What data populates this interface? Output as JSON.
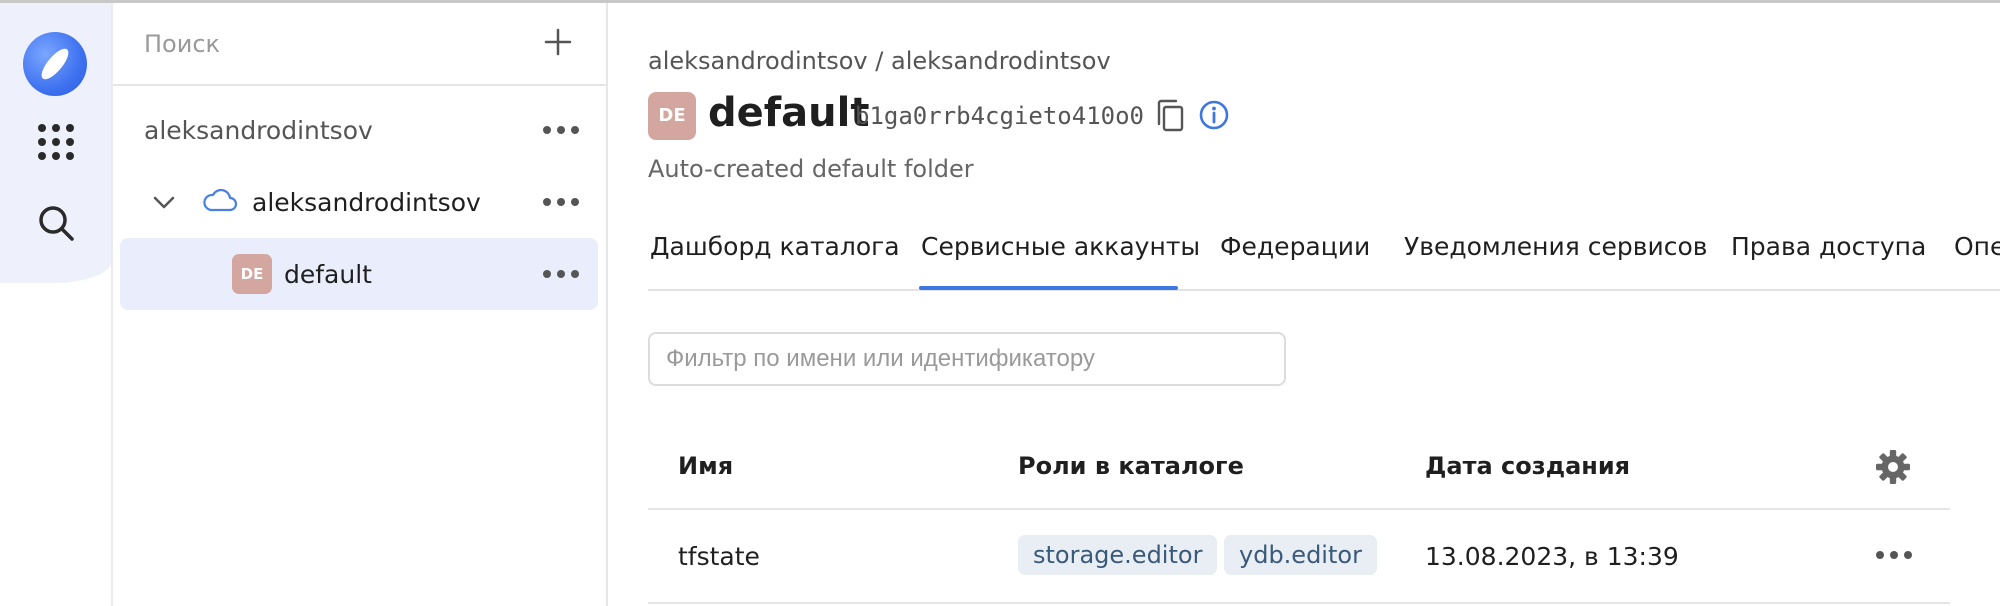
{
  "sidebar": {
    "search_placeholder": "Поиск",
    "nodes": [
      {
        "label": "aleksandrodintsov",
        "level": "organization"
      },
      {
        "label": "aleksandrodintsov",
        "level": "cloud",
        "expanded": true
      },
      {
        "label": "default",
        "level": "folder",
        "avatar": "DE",
        "selected": true
      }
    ]
  },
  "breadcrumb": {
    "org": "aleksandrodintsov",
    "separator": "/",
    "cloud": "aleksandrodintsov"
  },
  "folder": {
    "avatar": "DE",
    "name": "default",
    "id": "b1ga0rrb4cgieto410o0",
    "description": "Auto-created default folder"
  },
  "tabs": [
    {
      "label": "Дашборд каталога"
    },
    {
      "label": "Сервисные аккаунты",
      "active": true
    },
    {
      "label": "Федерации"
    },
    {
      "label": "Уведомления сервисов"
    },
    {
      "label": "Права доступа"
    },
    {
      "label": "Опе"
    }
  ],
  "filter": {
    "placeholder": "Фильтр по имени или идентификатору",
    "value": ""
  },
  "table": {
    "columns": [
      "Имя",
      "Роли в каталоге",
      "Дата создания"
    ],
    "rows": [
      {
        "name": "tfstate",
        "roles": [
          "storage.editor",
          "ydb.editor"
        ],
        "created": "13.08.2023, в 13:39"
      }
    ]
  },
  "colors": {
    "accent": "#3c78e0",
    "avatar": "#d4a6a0",
    "selected_row": "#eaeefc",
    "role_chip": "#e9eef4"
  }
}
